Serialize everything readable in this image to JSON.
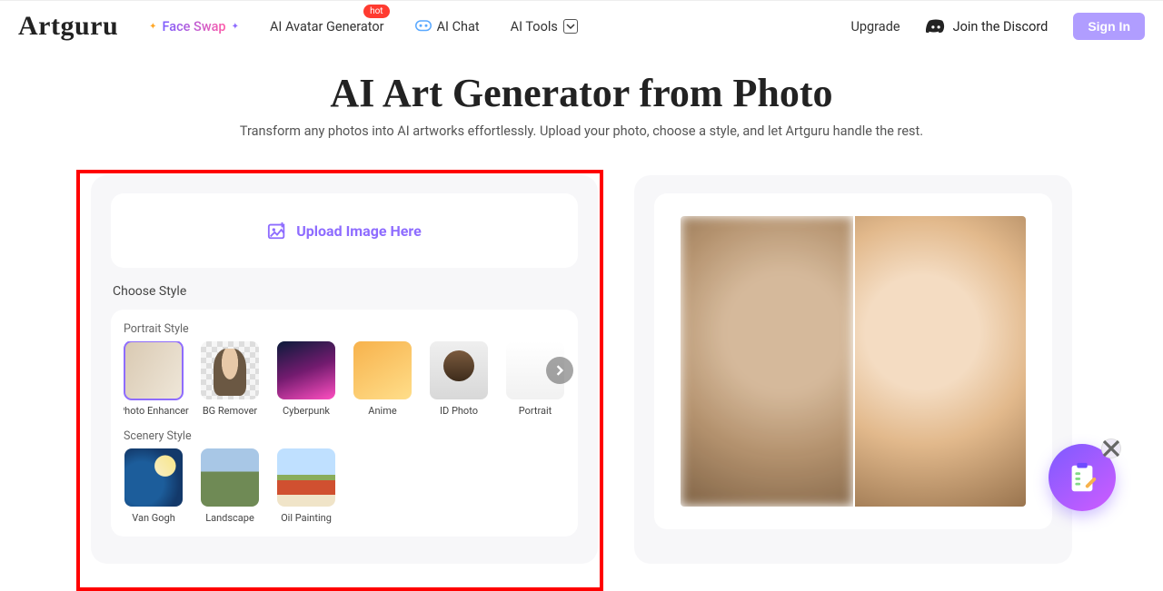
{
  "brand": "Artguru",
  "nav": {
    "faceswap": "Face Swap",
    "avatar": "AI Avatar Generator",
    "avatar_badge": "hot",
    "chat": "AI Chat",
    "tools": "AI Tools"
  },
  "right": {
    "upgrade": "Upgrade",
    "discord": "Join the Discord",
    "signin": "Sign In"
  },
  "hero": {
    "title": "AI Art Generator from Photo",
    "subtitle": "Transform any photos into AI artworks effortlessly. Upload your photo, choose a style, and let Artguru handle the rest."
  },
  "upload": {
    "label": "Upload Image Here"
  },
  "styles": {
    "choose": "Choose Style",
    "portrait_label": "Portrait Style",
    "scenery_label": "Scenery Style",
    "portrait": [
      {
        "name": "Photo Enhancer",
        "class": "t-enh",
        "selected": true
      },
      {
        "name": "BG Remover",
        "class": "t-bg"
      },
      {
        "name": "Cyberpunk",
        "class": "t-cyb"
      },
      {
        "name": "Anime",
        "class": "t-ani"
      },
      {
        "name": "ID Photo",
        "class": "t-id"
      },
      {
        "name": "Portrait",
        "class": "t-por"
      }
    ],
    "scenery": [
      {
        "name": "Van Gogh",
        "class": "t-vg"
      },
      {
        "name": "Landscape",
        "class": "t-ls"
      },
      {
        "name": "Oil Painting",
        "class": "t-oil"
      }
    ]
  }
}
